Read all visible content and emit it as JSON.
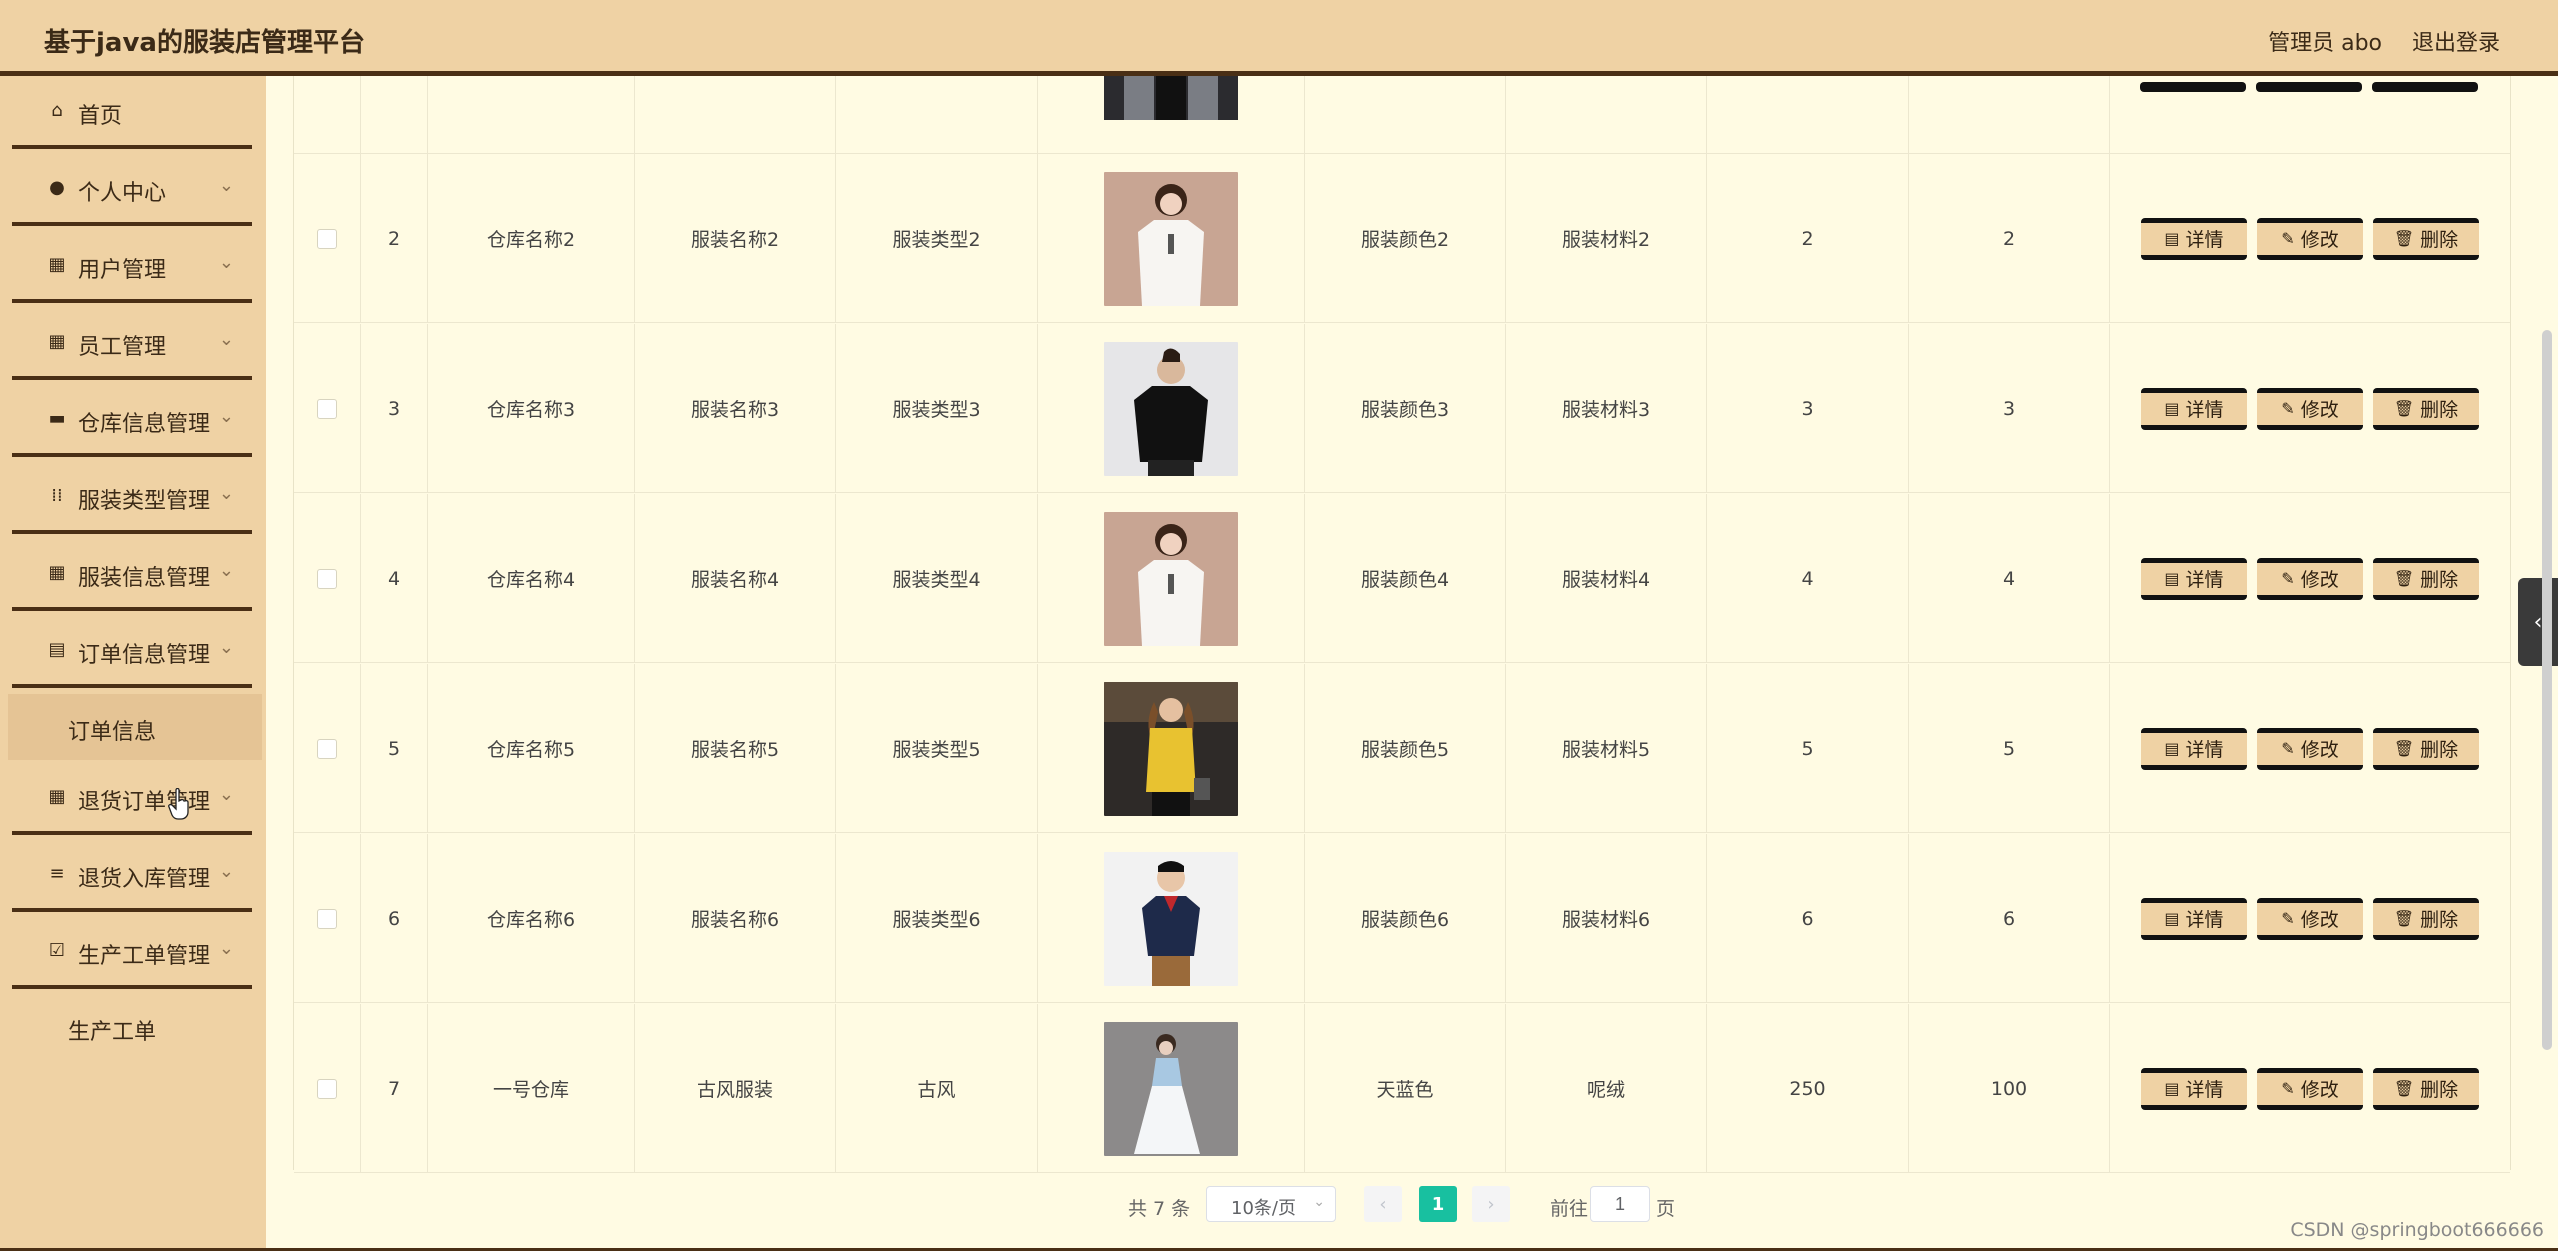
{
  "header": {
    "title": "基于java的服装店管理平台",
    "admin": "管理员 abo",
    "logout": "退出登录"
  },
  "sidebar": {
    "items": [
      {
        "label": "首页",
        "icon": "home-icon"
      },
      {
        "label": "个人中心",
        "icon": "user-icon"
      },
      {
        "label": "用户管理",
        "icon": "grid-icon"
      },
      {
        "label": "员工管理",
        "icon": "grid-icon"
      },
      {
        "label": "仓库信息管理",
        "icon": "briefcase-icon"
      },
      {
        "label": "服装类型管理",
        "icon": "apps-icon"
      },
      {
        "label": "服装信息管理",
        "icon": "grid-icon"
      },
      {
        "label": "订单信息管理",
        "icon": "clipboard-icon"
      },
      {
        "label": "退货订单管理",
        "icon": "grid-icon"
      },
      {
        "label": "退货入库管理",
        "icon": "sliders-icon"
      },
      {
        "label": "生产工单管理",
        "icon": "check-square-icon"
      }
    ],
    "sub_order": "订单信息",
    "sub_production": "生产工单"
  },
  "table": {
    "rows": [
      {
        "id": "2",
        "warehouse": "仓库名称2",
        "name": "服装名称2",
        "type": "服装类型2",
        "color": "服装颜色2",
        "material": "服装材料2",
        "qty": "2",
        "stock": "2",
        "image": "white-top"
      },
      {
        "id": "3",
        "warehouse": "仓库名称3",
        "name": "服装名称3",
        "type": "服装类型3",
        "color": "服装颜色3",
        "material": "服装材料3",
        "qty": "3",
        "stock": "3",
        "image": "black-tee"
      },
      {
        "id": "4",
        "warehouse": "仓库名称4",
        "name": "服装名称4",
        "type": "服装类型4",
        "color": "服装颜色4",
        "material": "服装材料4",
        "qty": "4",
        "stock": "4",
        "image": "white-top"
      },
      {
        "id": "5",
        "warehouse": "仓库名称5",
        "name": "服装名称5",
        "type": "服装类型5",
        "color": "服装颜色5",
        "material": "服装材料5",
        "qty": "5",
        "stock": "5",
        "image": "yellow-top"
      },
      {
        "id": "6",
        "warehouse": "仓库名称6",
        "name": "服装名称6",
        "type": "服装类型6",
        "color": "服装颜色6",
        "material": "服装材料6",
        "qty": "6",
        "stock": "6",
        "image": "kid-polo"
      },
      {
        "id": "7",
        "warehouse": "一号仓库",
        "name": "古风服装",
        "type": "古风",
        "color": "天蓝色",
        "material": "呢绒",
        "qty": "250",
        "stock": "100",
        "image": "ancient-dress"
      }
    ],
    "actions": {
      "detail": "详情",
      "edit": "修改",
      "delete": "删除"
    }
  },
  "pagination": {
    "total": "共 7 条",
    "page_size": "10条/页",
    "current": "1",
    "goto_label": "前往",
    "goto_value": "1",
    "page_unit": "页"
  },
  "watermark": "CSDN @springboot666666"
}
